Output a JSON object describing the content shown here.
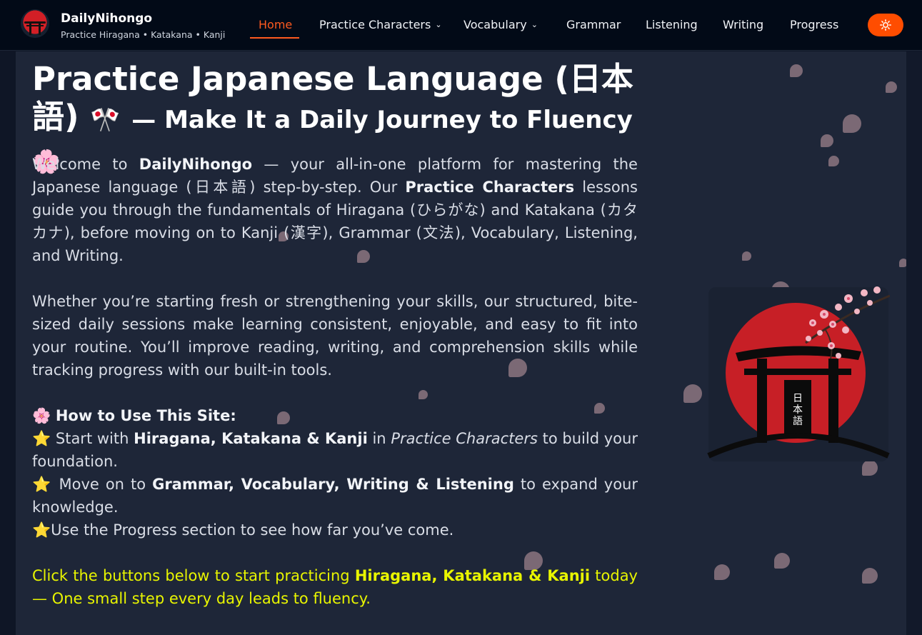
{
  "brand": {
    "name": "DailyNihongo",
    "tagline": "Practice Hiragana • Katakana • Kanji",
    "logo_icon": "torii-gate-logo-icon"
  },
  "nav": {
    "items": [
      {
        "label": "Home",
        "active": true,
        "dropdown": false
      },
      {
        "label": "Practice Characters",
        "active": false,
        "dropdown": true
      },
      {
        "label": "Vocabulary",
        "active": false,
        "dropdown": true
      },
      {
        "label": "Grammar",
        "active": false,
        "dropdown": false
      },
      {
        "label": "Listening",
        "active": false,
        "dropdown": false
      },
      {
        "label": "Writing",
        "active": false,
        "dropdown": false
      },
      {
        "label": "Progress",
        "active": false,
        "dropdown": false
      }
    ],
    "theme_toggle_icon": "sun-icon"
  },
  "hero": {
    "title_main": "Practice Japanese Language (日本語)",
    "title_flag": "🎌",
    "title_sub": "— Make It a Daily Journey to Fluency",
    "title_flower": "🌸",
    "intro": {
      "p1_a": "Welcome to",
      "p1_b": "DailyNihongo",
      "p1_c": "— your all-in-one platform for mastering the Japanese language (日本語) step-by-step. Our",
      "p1_d": "Practice Characters",
      "p1_e": "lessons guide you through the fundamentals of Hiragana (ひらがな) and Katakana (カタカナ), before moving on to Kanji (漢字), Grammar (文法), Vocabulary, Listening, and Writing."
    },
    "p2": "Whether you’re starting fresh or strengthening your skills, our structured, bite-sized daily sessions make learning consistent, enjoyable, and easy to fit into your routine. You’ll improve reading, writing, and comprehension skills while tracking progress with our built-in tools.",
    "how": {
      "icon": "🌸",
      "title": "How to Use This Site:",
      "step_icon": "⭐",
      "step1_a": "Start with",
      "step1_b": "Hiragana, Katakana & Kanji",
      "step1_c": "in",
      "step1_d": "Practice Characters",
      "step1_e": "to build your foundation.",
      "step2_a": "Move on to",
      "step2_b": "Grammar, Vocabulary, Writing & Listening",
      "step2_c": "to expand your knowledge.",
      "step3": "Use the Progress section to see how far you’ve come."
    },
    "cta_a": "Click the buttons below to start practicing",
    "cta_b": "Hiragana, Katakana & Kanji",
    "cta_c": "today — One small step every day leads to fluency.",
    "art_label": "日本語",
    "art_icon": "torii-sun-blossom-illustration",
    "accent_color": "#ff5a1f",
    "highlight_color": "#e8f500"
  }
}
